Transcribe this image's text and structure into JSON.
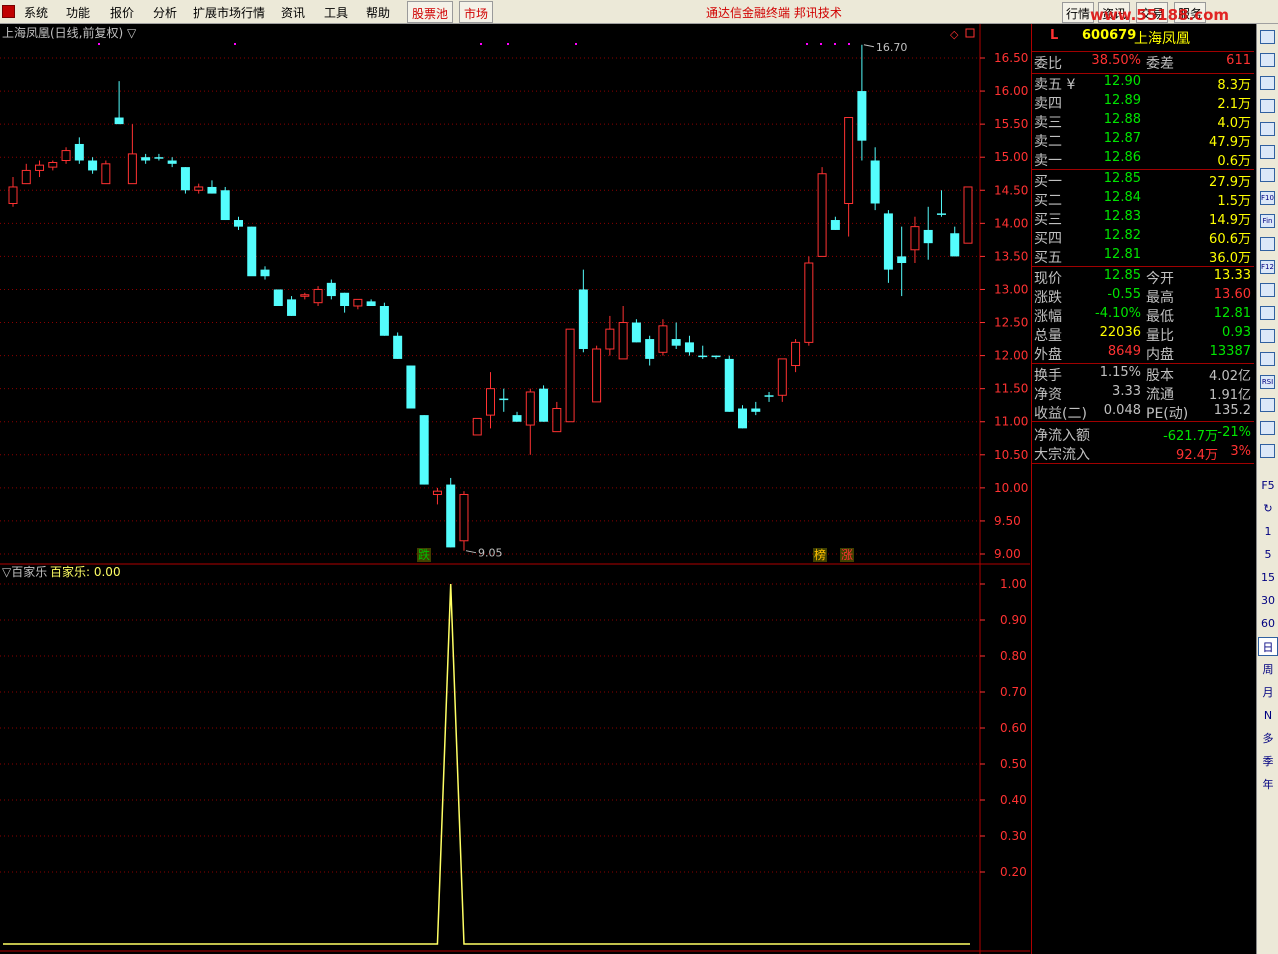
{
  "menu": {
    "items": [
      "系统",
      "功能",
      "报价",
      "分析",
      "扩展市场行情",
      "资讯",
      "工具",
      "帮助"
    ],
    "tabs": [
      "股票池",
      "市场"
    ],
    "brand": "通达信金融终端  邦讯技术",
    "right_tabs": [
      "行情",
      "资讯",
      "交易",
      "服务"
    ],
    "watermark": "www.55188.com"
  },
  "chart": {
    "title": "上海凤凰(日线,前复权) ▽",
    "high_label": "16.70",
    "low_label": "9.05",
    "markers": [
      "跌",
      "榜",
      "涨"
    ],
    "price_axis": [
      "16.50",
      "16.00",
      "15.50",
      "15.00",
      "14.50",
      "14.00",
      "13.50",
      "13.00",
      "12.50",
      "12.00",
      "11.50",
      "11.00",
      "10.50",
      "10.00",
      "9.50",
      "9.00"
    ],
    "colors": {
      "up": "#ff3232",
      "down": "#54fcfc",
      "grid": "#8b0000",
      "axis": "#ff3232",
      "indicator": "#ffff64"
    }
  },
  "indicator": {
    "name": "▽百家乐",
    "value_label": "百家乐: 0.00",
    "axis": [
      "1.00",
      "0.90",
      "0.80",
      "0.70",
      "0.60",
      "0.50",
      "0.40",
      "0.30",
      "0.20"
    ]
  },
  "chart_data": {
    "type": "candlestick",
    "candles": [
      [
        14.3,
        14.7,
        14.25,
        14.55
      ],
      [
        14.6,
        14.9,
        14.6,
        14.8
      ],
      [
        14.8,
        14.95,
        14.7,
        14.88
      ],
      [
        14.85,
        14.95,
        14.8,
        14.92
      ],
      [
        14.95,
        15.15,
        14.9,
        15.1
      ],
      [
        15.2,
        15.3,
        14.9,
        14.95
      ],
      [
        14.95,
        15.0,
        14.75,
        14.8
      ],
      [
        14.6,
        14.95,
        14.6,
        14.9
      ],
      [
        15.6,
        16.15,
        15.5,
        15.5
      ],
      [
        14.6,
        15.5,
        14.6,
        15.05
      ],
      [
        15.0,
        15.05,
        14.9,
        14.95
      ],
      [
        15.0,
        15.05,
        14.95,
        15.0
      ],
      [
        14.95,
        15.0,
        14.85,
        14.9
      ],
      [
        14.85,
        14.85,
        14.45,
        14.5
      ],
      [
        14.5,
        14.6,
        14.45,
        14.55
      ],
      [
        14.55,
        14.65,
        14.45,
        14.45
      ],
      [
        14.5,
        14.55,
        14.05,
        14.05
      ],
      [
        14.05,
        14.1,
        13.9,
        13.95
      ],
      [
        13.95,
        13.95,
        13.25,
        13.2
      ],
      [
        13.3,
        13.35,
        13.15,
        13.2
      ],
      [
        13.0,
        13.0,
        12.75,
        12.75
      ],
      [
        12.85,
        12.9,
        12.6,
        12.6
      ],
      [
        12.9,
        12.95,
        12.85,
        12.92
      ],
      [
        12.8,
        13.05,
        12.75,
        13.0
      ],
      [
        13.1,
        13.15,
        12.85,
        12.9
      ],
      [
        12.95,
        12.95,
        12.65,
        12.75
      ],
      [
        12.75,
        12.85,
        12.7,
        12.85
      ],
      [
        12.82,
        12.85,
        12.75,
        12.75
      ],
      [
        12.75,
        12.8,
        12.3,
        12.3
      ],
      [
        12.3,
        12.35,
        11.95,
        11.95
      ],
      [
        11.85,
        11.85,
        11.2,
        11.2
      ],
      [
        11.1,
        11.1,
        10.05,
        10.05
      ],
      [
        9.9,
        10.0,
        9.75,
        9.95
      ],
      [
        10.05,
        10.15,
        9.1,
        9.1
      ],
      [
        9.2,
        9.95,
        9.05,
        9.9
      ],
      [
        10.8,
        11.0,
        10.8,
        11.05
      ],
      [
        11.1,
        11.75,
        10.9,
        11.5
      ],
      [
        11.35,
        11.5,
        11.15,
        11.35
      ],
      [
        11.1,
        11.15,
        11.0,
        11.0
      ],
      [
        10.95,
        11.5,
        10.5,
        11.45
      ],
      [
        11.5,
        11.55,
        11.0,
        11.0
      ],
      [
        10.85,
        11.3,
        10.85,
        11.2
      ],
      [
        11.0,
        12.35,
        11.0,
        12.4
      ],
      [
        13.0,
        13.3,
        12.05,
        12.1
      ],
      [
        11.3,
        12.15,
        11.3,
        12.1
      ],
      [
        12.1,
        12.6,
        12.0,
        12.4
      ],
      [
        11.95,
        12.75,
        11.95,
        12.5
      ],
      [
        12.5,
        12.55,
        12.2,
        12.2
      ],
      [
        12.25,
        12.3,
        11.85,
        11.95
      ],
      [
        12.05,
        12.55,
        12.0,
        12.45
      ],
      [
        12.25,
        12.5,
        12.1,
        12.15
      ],
      [
        12.2,
        12.3,
        12.0,
        12.05
      ],
      [
        12.0,
        12.15,
        11.95,
        12.0
      ],
      [
        12.0,
        12.0,
        11.95,
        12.0
      ],
      [
        11.95,
        12.0,
        11.15,
        11.15
      ],
      [
        11.2,
        11.25,
        10.9,
        10.9
      ],
      [
        11.2,
        11.3,
        11.1,
        11.15
      ],
      [
        11.4,
        11.45,
        11.3,
        11.4
      ],
      [
        11.4,
        11.95,
        11.3,
        11.95
      ],
      [
        11.85,
        12.25,
        11.75,
        12.2
      ],
      [
        12.2,
        13.5,
        12.15,
        13.4
      ],
      [
        13.5,
        14.85,
        13.5,
        14.75
      ],
      [
        14.05,
        14.1,
        13.9,
        13.9
      ],
      [
        14.3,
        15.6,
        13.8,
        15.6
      ],
      [
        16.0,
        16.7,
        14.95,
        15.25
      ],
      [
        14.95,
        15.15,
        14.2,
        14.3
      ],
      [
        14.15,
        14.2,
        13.1,
        13.3
      ],
      [
        13.5,
        13.95,
        12.9,
        13.4
      ],
      [
        13.6,
        14.1,
        13.4,
        13.95
      ],
      [
        13.9,
        14.25,
        13.45,
        13.7
      ],
      [
        14.15,
        14.5,
        14.1,
        14.15
      ],
      [
        13.85,
        13.95,
        13.5,
        13.5
      ],
      [
        13.7,
        14.55,
        13.7,
        14.55
      ]
    ],
    "indicator_series": {
      "name": "百家乐",
      "values": [
        0,
        0,
        0,
        0,
        0,
        0,
        0,
        0,
        0,
        0,
        0,
        0,
        0,
        0,
        0,
        0,
        0,
        0,
        0,
        0,
        0,
        0,
        0,
        0,
        0,
        0,
        0,
        0,
        0,
        0,
        0,
        0,
        0,
        1,
        0,
        0,
        0,
        0,
        0,
        0,
        0,
        0,
        0,
        0,
        0,
        0,
        0,
        0,
        0,
        0,
        0,
        0,
        0,
        0,
        0,
        0,
        0,
        0,
        0,
        0,
        0,
        0,
        0,
        0,
        0,
        0,
        0,
        0,
        0,
        0,
        0,
        0,
        0
      ],
      "ylim": [
        0,
        1
      ]
    },
    "ylim": [
      9.0,
      16.7
    ]
  },
  "quote": {
    "header": {
      "flag": "L",
      "code": "600679",
      "name": "上海凤凰"
    },
    "weibi": {
      "label": "委比",
      "value": "38.50%",
      "label2": "委差",
      "value2": "611"
    },
    "asks": [
      {
        "label": "卖五 ¥",
        "price": "12.90",
        "vol": "8.3万"
      },
      {
        "label": "卖四",
        "price": "12.89",
        "vol": "2.1万"
      },
      {
        "label": "卖三",
        "price": "12.88",
        "vol": "4.0万"
      },
      {
        "label": "卖二",
        "price": "12.87",
        "vol": "47.9万"
      },
      {
        "label": "卖一",
        "price": "12.86",
        "vol": "0.6万"
      }
    ],
    "bids": [
      {
        "label": "买一",
        "price": "12.85",
        "vol": "27.9万"
      },
      {
        "label": "买二",
        "price": "12.84",
        "vol": "1.5万"
      },
      {
        "label": "买三",
        "price": "12.83",
        "vol": "14.9万"
      },
      {
        "label": "买四",
        "price": "12.82",
        "vol": "60.6万"
      },
      {
        "label": "买五",
        "price": "12.81",
        "vol": "36.0万"
      }
    ],
    "stats": [
      {
        "l1": "现价",
        "v1": "12.85",
        "c1": "#00e600",
        "l2": "今开",
        "v2": "13.33",
        "c2": "#ffff00"
      },
      {
        "l1": "涨跌",
        "v1": "-0.55",
        "c1": "#00e600",
        "l2": "最高",
        "v2": "13.60",
        "c2": "#ff3232"
      },
      {
        "l1": "涨幅",
        "v1": "-4.10%",
        "c1": "#00e600",
        "l2": "最低",
        "v2": "12.81",
        "c2": "#00e600"
      },
      {
        "l1": "总量",
        "v1": "22036",
        "c1": "#ffff00",
        "l2": "量比",
        "v2": "0.93",
        "c2": "#00e600"
      },
      {
        "l1": "外盘",
        "v1": "8649",
        "c1": "#ff3232",
        "l2": "内盘",
        "v2": "13387",
        "c2": "#00e600"
      }
    ],
    "fund": [
      {
        "l1": "换手",
        "v1": "1.15%",
        "l2": "股本",
        "v2": "4.02亿"
      },
      {
        "l1": "净资",
        "v1": "3.33",
        "l2": "流通",
        "v2": "1.91亿"
      },
      {
        "l1": "收益(二)",
        "v1": "0.048",
        "l2": "PE(动)",
        "v2": "135.2"
      }
    ],
    "flows": [
      {
        "label": "净流入额",
        "value": "-621.7万",
        "pct": "-21%",
        "color": "#00e600"
      },
      {
        "label": "大宗流入",
        "value": "92.4万",
        "pct": "3%",
        "color": "#ff3232"
      }
    ]
  },
  "toolbar": {
    "icons": [
      "help-icon",
      "up-arrow-icon",
      "down-arrow-icon",
      "screen-icon",
      "table-icon",
      "line-chart-icon",
      "candle-icon",
      "f10-icon",
      "fin-icon",
      "doc-icon",
      "f12-icon",
      "paper-icon",
      "circle-icon",
      "blank-icon",
      "wave-icon",
      "rsi-icon",
      "money-icon",
      "move-icon",
      "pen-icon"
    ],
    "icon_labels": {
      "f10-icon": "F10",
      "fin-icon": "Fin",
      "f12-icon": "F12",
      "rsi-icon": "RSI"
    },
    "periods": [
      "F5",
      "↻",
      "1",
      "5",
      "15",
      "30",
      "60",
      "日",
      "周",
      "月",
      "N",
      "多",
      "季",
      "年"
    ]
  }
}
